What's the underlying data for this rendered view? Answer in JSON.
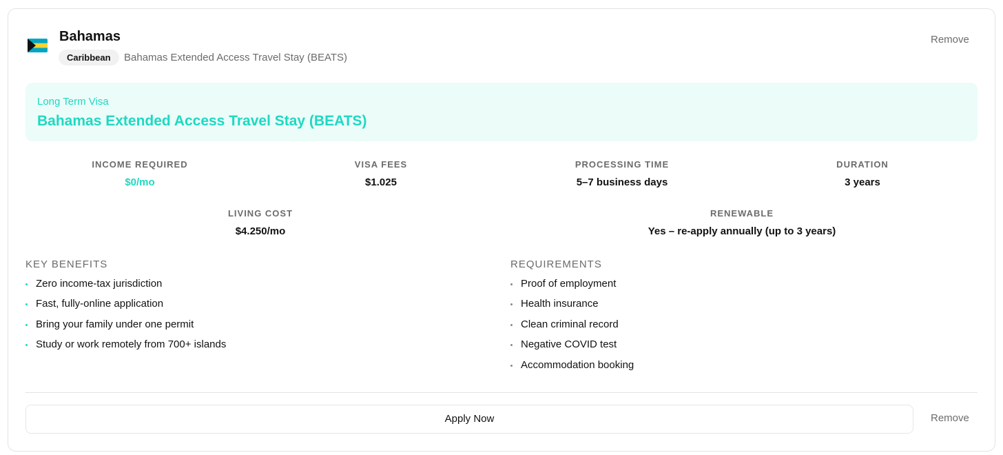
{
  "header": {
    "flag_icon": "bahamas-flag-icon",
    "country": "Bahamas",
    "region": "Caribbean",
    "visa_name": "Bahamas Extended Access Travel Stay (BEATS)",
    "remove_label": "Remove"
  },
  "highlight": {
    "type": "Long Term Visa",
    "name": "Bahamas Extended Access Travel Stay (BEATS)"
  },
  "stats": {
    "income_required": {
      "label": "INCOME REQUIRED",
      "value": "$0/mo"
    },
    "visa_fees": {
      "label": "VISA FEES",
      "value": "$1.025"
    },
    "processing_time": {
      "label": "PROCESSING TIME",
      "value": "5–7 business days"
    },
    "duration": {
      "label": "DURATION",
      "value": "3 years"
    },
    "living_cost": {
      "label": "LIVING COST",
      "value": "$4.250/mo"
    },
    "renewable": {
      "label": "RENEWABLE",
      "value": "Yes – re-apply annually (up to 3 years)"
    }
  },
  "benefits": {
    "title": "KEY BENEFITS",
    "items": [
      "Zero income-tax jurisdiction",
      "Fast, fully-online application",
      "Bring your family under one permit",
      "Study or work remotely from 700+ islands"
    ]
  },
  "requirements": {
    "title": "REQUIREMENTS",
    "items": [
      "Proof of employment",
      "Health insurance",
      "Clean criminal record",
      "Negative COVID test",
      "Accommodation booking"
    ]
  },
  "footer": {
    "apply_label": "Apply Now",
    "remove_label": "Remove"
  },
  "colors": {
    "accent": "#1fd8c2",
    "highlight_bg": "#ebfcf9",
    "muted_text": "#6b6b6b",
    "border": "#e3e3e3"
  }
}
